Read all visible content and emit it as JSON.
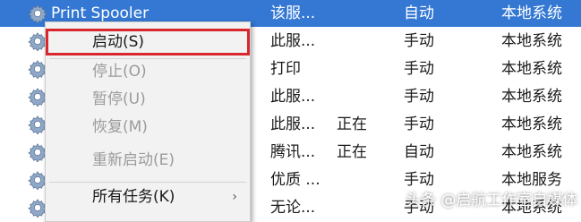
{
  "services": [
    {
      "name": "Print Spooler",
      "description": "该服...",
      "status": "",
      "startup": "自动",
      "logon": "本地系统",
      "selected": true
    },
    {
      "name": "",
      "description": "此服...",
      "status": "",
      "startup": "手动",
      "logon": "本地系统"
    },
    {
      "name": "",
      "description": "打印",
      "status": "",
      "startup": "手动",
      "logon": "本地系统"
    },
    {
      "name": "",
      "description": "此服...",
      "status": "",
      "startup": "手动",
      "logon": "本地系统"
    },
    {
      "name": "",
      "description": "此服...",
      "status": "正在",
      "startup": "手动",
      "logon": "本地系统"
    },
    {
      "name": "",
      "description": "腾讯...",
      "status": "正在",
      "startup": "自动",
      "logon": "本地系统"
    },
    {
      "name": "",
      "description": "优质 ...",
      "status": "",
      "startup": "手动",
      "logon": "本地服务"
    },
    {
      "name": "",
      "description": "无论...",
      "status": "",
      "startup": "手动",
      "logon": "本地系统"
    }
  ],
  "context_menu": {
    "items": [
      {
        "label": "启动(S)",
        "enabled": true,
        "highlighted": true
      },
      {
        "label": "停止(O)",
        "enabled": false
      },
      {
        "label": "暂停(U)",
        "enabled": false
      },
      {
        "label": "恢复(M)",
        "enabled": false
      },
      {
        "label": "重新启动(E)",
        "enabled": false
      },
      {
        "label": "所有任务(K)",
        "enabled": true,
        "submenu_arrow": "›"
      }
    ]
  },
  "watermark": "头条 @启航工作室自媒体",
  "colors": {
    "selection": "#3478d4",
    "highlight_border": "#d9272e",
    "disabled_text": "#9b9b9b",
    "menu_background": "#f2f2f2"
  },
  "icons": {
    "service": "gear-icon",
    "submenu": "chevron-right-icon"
  }
}
